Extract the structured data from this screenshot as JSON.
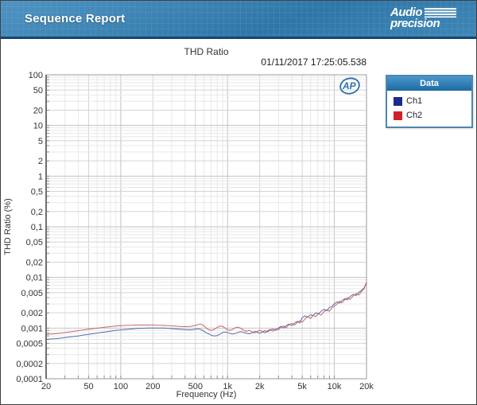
{
  "header": {
    "title": "Sequence Report",
    "logo_line1": "Audio",
    "logo_line2": "precision"
  },
  "report": {
    "chart_title": "THD Ratio",
    "timestamp": "01/11/2017 17:25:05.538"
  },
  "ap_badge": "AP",
  "legend": {
    "title": "Data",
    "items": [
      {
        "label": "Ch1",
        "color": "#1b2a8c"
      },
      {
        "label": "Ch2",
        "color": "#cf2128"
      }
    ]
  },
  "chart_data": {
    "type": "line",
    "title": "THD Ratio",
    "xlabel": "Frequency (Hz)",
    "ylabel": "THD Ratio (%)",
    "x_scale": "log",
    "y_scale": "log",
    "xlim": [
      20,
      20000
    ],
    "ylim": [
      0.0001,
      100
    ],
    "grid": true,
    "legend_position": "outside-top-right",
    "x_ticks": [
      {
        "v": 20,
        "label": "20"
      },
      {
        "v": 50,
        "label": "50"
      },
      {
        "v": 100,
        "label": "100"
      },
      {
        "v": 200,
        "label": "200"
      },
      {
        "v": 500,
        "label": "500"
      },
      {
        "v": 1000,
        "label": "1k"
      },
      {
        "v": 2000,
        "label": "2k"
      },
      {
        "v": 5000,
        "label": "5k"
      },
      {
        "v": 10000,
        "label": "10k"
      },
      {
        "v": 20000,
        "label": "20k"
      }
    ],
    "y_ticks": [
      {
        "v": 100,
        "label": "100"
      },
      {
        "v": 50,
        "label": "50"
      },
      {
        "v": 20,
        "label": "20"
      },
      {
        "v": 10,
        "label": "10"
      },
      {
        "v": 5,
        "label": "5"
      },
      {
        "v": 2,
        "label": "2"
      },
      {
        "v": 1,
        "label": "1"
      },
      {
        "v": 0.5,
        "label": "0,5"
      },
      {
        "v": 0.2,
        "label": "0,2"
      },
      {
        "v": 0.1,
        "label": "0,1"
      },
      {
        "v": 0.05,
        "label": "0,05"
      },
      {
        "v": 0.02,
        "label": "0,02"
      },
      {
        "v": 0.01,
        "label": "0,01"
      },
      {
        "v": 0.005,
        "label": "0,005"
      },
      {
        "v": 0.002,
        "label": "0,002"
      },
      {
        "v": 0.001,
        "label": "0,001"
      },
      {
        "v": 0.0005,
        "label": "0,0005"
      },
      {
        "v": 0.0002,
        "label": "0,0002"
      },
      {
        "v": 0.0001,
        "label": "0,0001"
      }
    ],
    "x": [
      20,
      22,
      25,
      28,
      32,
      36,
      40,
      45,
      50,
      56,
      63,
      71,
      80,
      90,
      100,
      112,
      125,
      140,
      160,
      180,
      200,
      224,
      250,
      280,
      315,
      355,
      400,
      450,
      500,
      530,
      560,
      600,
      630,
      670,
      710,
      750,
      800,
      850,
      900,
      950,
      1000,
      1060,
      1120,
      1180,
      1250,
      1320,
      1400,
      1500,
      1600,
      1700,
      1800,
      1900,
      2000,
      2120,
      2240,
      2360,
      2500,
      2650,
      2800,
      3000,
      3150,
      3350,
      3550,
      3750,
      4000,
      4250,
      4500,
      4750,
      5000,
      5300,
      5600,
      6000,
      6300,
      6700,
      7100,
      7500,
      8000,
      8500,
      9000,
      9500,
      10000,
      10600,
      11200,
      11800,
      12500,
      13200,
      14000,
      15000,
      16000,
      17000,
      18000,
      19000,
      20000
    ],
    "series": [
      {
        "name": "Ch1",
        "line_color": "#3d55a0",
        "values": [
          0.0006,
          0.00061,
          0.00062,
          0.00064,
          0.00066,
          0.00068,
          0.0007,
          0.00073,
          0.00075,
          0.00078,
          0.00081,
          0.00084,
          0.00087,
          0.0009,
          0.00092,
          0.00094,
          0.00096,
          0.00098,
          0.00099,
          0.001,
          0.001,
          0.001,
          0.001,
          0.00099,
          0.00097,
          0.00095,
          0.00093,
          0.00092,
          0.00095,
          0.00097,
          0.00094,
          0.00087,
          0.00081,
          0.00076,
          0.00072,
          0.0007,
          0.00071,
          0.00076,
          0.00082,
          0.00084,
          0.00082,
          0.00078,
          0.00076,
          0.00078,
          0.00082,
          0.00085,
          0.00083,
          0.00079,
          0.00077,
          0.00081,
          0.00086,
          0.00083,
          0.00079,
          0.00084,
          0.00089,
          0.00084,
          0.00091,
          0.00096,
          0.0009,
          0.001,
          0.00108,
          0.00101,
          0.00112,
          0.0012,
          0.00112,
          0.00126,
          0.00135,
          0.00126,
          0.0016,
          0.00175,
          0.00163,
          0.00185,
          0.00175,
          0.002,
          0.0019,
          0.00215,
          0.00235,
          0.0022,
          0.00255,
          0.0027,
          0.003,
          0.0033,
          0.0031,
          0.0035,
          0.0038,
          0.0036,
          0.0042,
          0.0046,
          0.0044,
          0.0051,
          0.0056,
          0.0062,
          0.0078
        ]
      },
      {
        "name": "Ch2",
        "line_color": "#c0504d",
        "values": [
          0.00075,
          0.00076,
          0.00078,
          0.0008,
          0.00083,
          0.00086,
          0.00089,
          0.00092,
          0.00095,
          0.00098,
          0.00101,
          0.00104,
          0.00107,
          0.0011,
          0.00112,
          0.00113,
          0.00114,
          0.00115,
          0.00115,
          0.00115,
          0.00115,
          0.00114,
          0.00113,
          0.00112,
          0.0011,
          0.00108,
          0.00107,
          0.00108,
          0.00113,
          0.00118,
          0.0012,
          0.00112,
          0.001,
          0.00092,
          0.0009,
          0.00094,
          0.00103,
          0.0011,
          0.00108,
          0.001,
          0.00092,
          0.0009,
          0.00095,
          0.00102,
          0.00105,
          0.001,
          0.00092,
          0.00086,
          0.0009,
          0.00084,
          0.0008,
          0.00086,
          0.00091,
          0.00085,
          0.0008,
          0.00088,
          0.00094,
          0.00087,
          0.00096,
          0.00092,
          0.00104,
          0.0011,
          0.00102,
          0.00116,
          0.00124,
          0.00115,
          0.0013,
          0.0014,
          0.0013,
          0.0015,
          0.00168,
          0.00155,
          0.0018,
          0.00168,
          0.00195,
          0.0018,
          0.0021,
          0.0023,
          0.00215,
          0.0025,
          0.0027,
          0.003,
          0.0034,
          0.00315,
          0.0036,
          0.004,
          0.0037,
          0.0043,
          0.0048,
          0.0045,
          0.0053,
          0.006,
          0.008
        ]
      }
    ]
  }
}
